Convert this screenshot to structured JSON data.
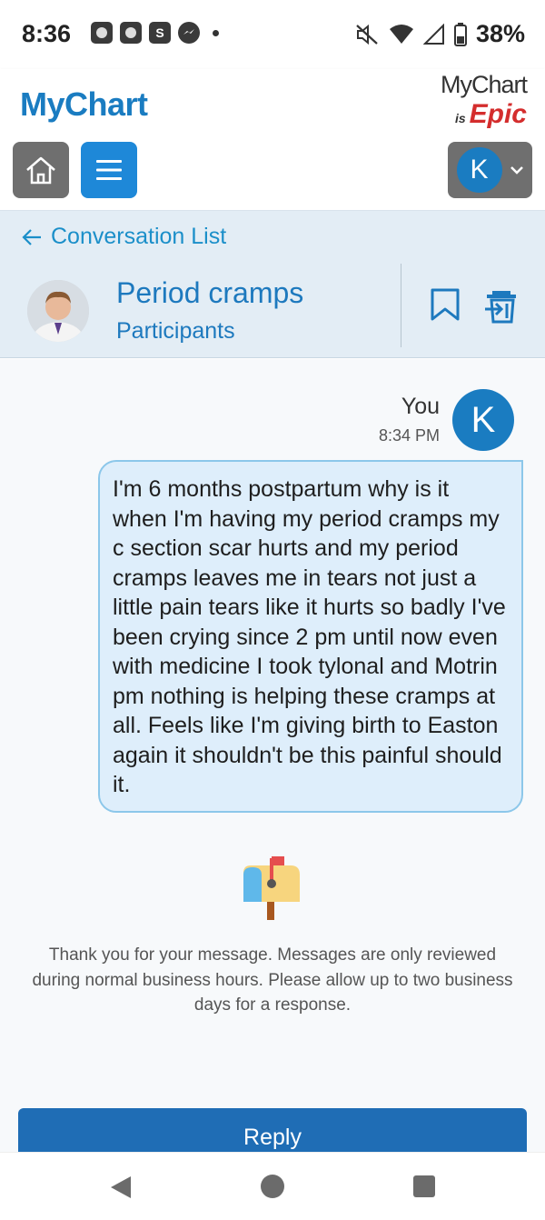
{
  "status_bar": {
    "time": "8:36",
    "notif_s_label": "S",
    "battery": "38%"
  },
  "header": {
    "brand": "MyChart",
    "epic_logo": {
      "line1": "MyChart",
      "is": "is",
      "epic": "Epic"
    },
    "account_initial": "K"
  },
  "conversation": {
    "back_label": "Conversation List",
    "subject": "Period cramps",
    "participants_label": "Participants"
  },
  "message": {
    "sender": "You",
    "sender_initial": "K",
    "time": "8:34 PM",
    "body": "I'm 6 months postpartum why is it when I'm having my period cramps my c section scar hurts and my period cramps leaves me in tears not just a little pain tears like it hurts so badly I've been crying since 2 pm until now even with medicine I took tylonal and Motrin pm nothing is helping these cramps at all. Feels like I'm giving birth to Easton again it shouldn't be this painful should it."
  },
  "notice": "Thank you for your message. Messages are only reviewed during normal business hours. Please allow up to two business days for a response.",
  "reply_label": "Reply",
  "colors": {
    "brand_blue": "#1a7cc1",
    "link_blue": "#1b8fc9",
    "bubble_bg": "#deeefb",
    "bubble_border": "#8cc7ea",
    "reply_button": "#1f6db5",
    "epic_red": "#d42d2d"
  }
}
